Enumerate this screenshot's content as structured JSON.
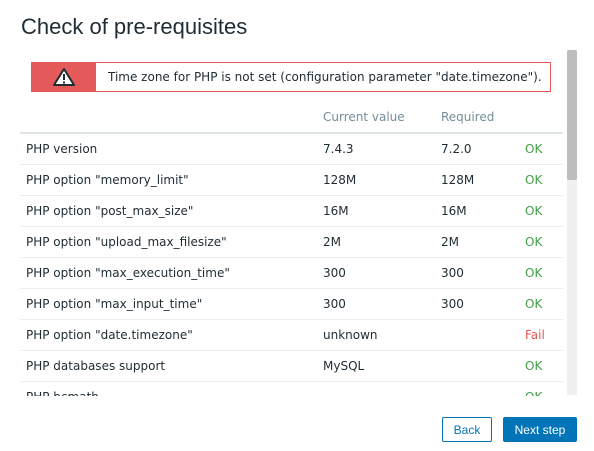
{
  "page": {
    "title": "Check of pre-requisites"
  },
  "alert": {
    "message": "Time zone for PHP is not set (configuration parameter \"date.timezone\").",
    "icon": "warning-icon",
    "color": "#e45959"
  },
  "table": {
    "headers": [
      "",
      "Current value",
      "Required",
      ""
    ],
    "rows": [
      {
        "name": "PHP version",
        "current": "7.4.3",
        "required": "7.2.0",
        "status": "OK"
      },
      {
        "name": "PHP option \"memory_limit\"",
        "current": "128M",
        "required": "128M",
        "status": "OK"
      },
      {
        "name": "PHP option \"post_max_size\"",
        "current": "16M",
        "required": "16M",
        "status": "OK"
      },
      {
        "name": "PHP option \"upload_max_filesize\"",
        "current": "2M",
        "required": "2M",
        "status": "OK"
      },
      {
        "name": "PHP option \"max_execution_time\"",
        "current": "300",
        "required": "300",
        "status": "OK"
      },
      {
        "name": "PHP option \"max_input_time\"",
        "current": "300",
        "required": "300",
        "status": "OK"
      },
      {
        "name": "PHP option \"date.timezone\"",
        "current": "unknown",
        "required": "",
        "status": "Fail"
      },
      {
        "name": "PHP databases support",
        "current": "MySQL",
        "required": "",
        "status": "OK"
      },
      {
        "name": "PHP bcmath",
        "current": "",
        "required": "",
        "status": "OK"
      }
    ]
  },
  "buttons": {
    "back": "Back",
    "next": "Next step"
  },
  "colors": {
    "ok": "#429e47",
    "fail": "#e45959",
    "accent": "#0275b8"
  }
}
